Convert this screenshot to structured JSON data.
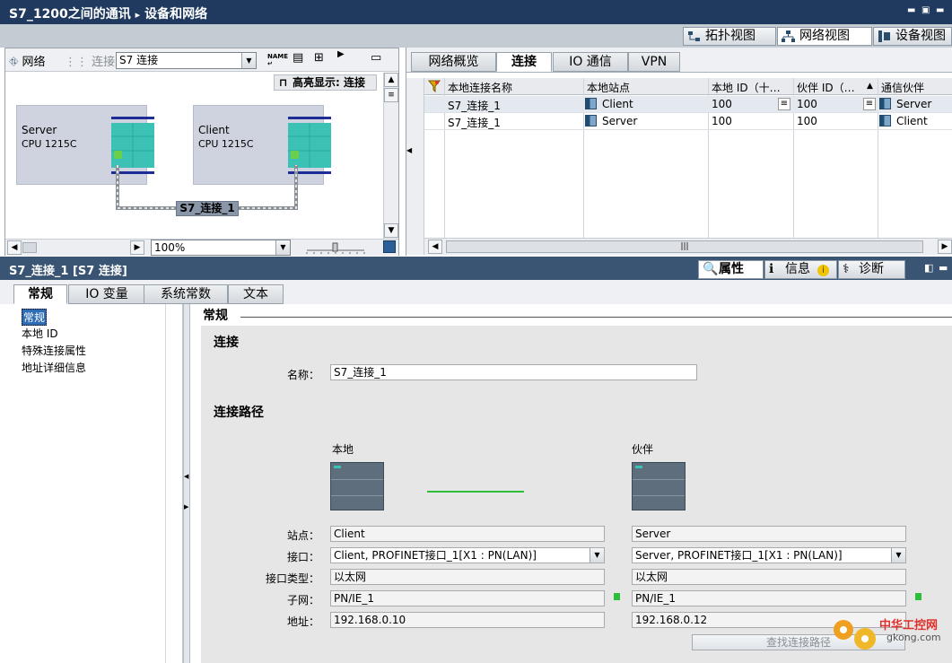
{
  "title": "S7_1200之间的通讯",
  "breadcrumb_sep": "▸",
  "breadcrumb_page": "设备和网络",
  "views": {
    "topology": "拓扑视图",
    "network": "网络视图",
    "device": "设备视图"
  },
  "net_toolbar": {
    "network": "网络",
    "connect": "连接",
    "connection_type": "S7 连接",
    "highlight": "高亮显示: 连接",
    "zoom": "100%"
  },
  "devices": [
    {
      "name": "Server",
      "cpu": "CPU 1215C"
    },
    {
      "name": "Client",
      "cpu": "CPU 1215C"
    }
  ],
  "connection_label": "S7_连接_1",
  "conn_tabs": [
    "网络概览",
    "连接",
    "IO 通信",
    "VPN"
  ],
  "grid": {
    "headers": [
      "本地连接名称",
      "本地站点",
      "本地 ID（十…",
      "伙伴 ID（…",
      "通信伙伴"
    ],
    "rows": [
      {
        "name": "S7_连接_1",
        "station": "Client",
        "local_id": "100",
        "partner_id": "100",
        "partner": "Server"
      },
      {
        "name": "S7_连接_1",
        "station": "Server",
        "local_id": "100",
        "partner_id": "100",
        "partner": "Client"
      }
    ]
  },
  "props": {
    "title": "S7_连接_1 [S7 连接]",
    "buttons": {
      "properties": "属性",
      "info": "信息",
      "diagnostics": "诊断"
    },
    "tabs": [
      "常规",
      "IO 变量",
      "系统常数",
      "文本"
    ],
    "nav": [
      "常规",
      "本地 ID",
      "特殊连接属性",
      "地址详细信息"
    ],
    "section": "常规",
    "conn_heading": "连接",
    "name_label": "名称：",
    "name_value": "S7_连接_1",
    "path_heading": "连接路径",
    "local": "本地",
    "partner": "伙伴",
    "labels": {
      "station": "站点：",
      "interface": "接口：",
      "interface_type": "接口类型：",
      "subnet": "子网：",
      "address": "地址："
    },
    "local_vals": {
      "station": "Client",
      "interface": "Client, PROFINET接口_1[X1 : PN(LAN)]",
      "interface_type": "以太网",
      "subnet": "PN/IE_1",
      "address": "192.168.0.10"
    },
    "partner_vals": {
      "station": "Server",
      "interface": "Server, PROFINET接口_1[X1 : PN(LAN)]",
      "interface_type": "以太网",
      "subnet": "PN/IE_1",
      "address": "192.168.0.12"
    },
    "find_path": "查找连接路径"
  },
  "watermark": {
    "cn": "中华工控网",
    "url": "gkong.com"
  },
  "colors": {
    "title_bg": "#1f3a5e",
    "plc_teal": "#3cc2b4",
    "link_green": "#2fbe3a"
  }
}
